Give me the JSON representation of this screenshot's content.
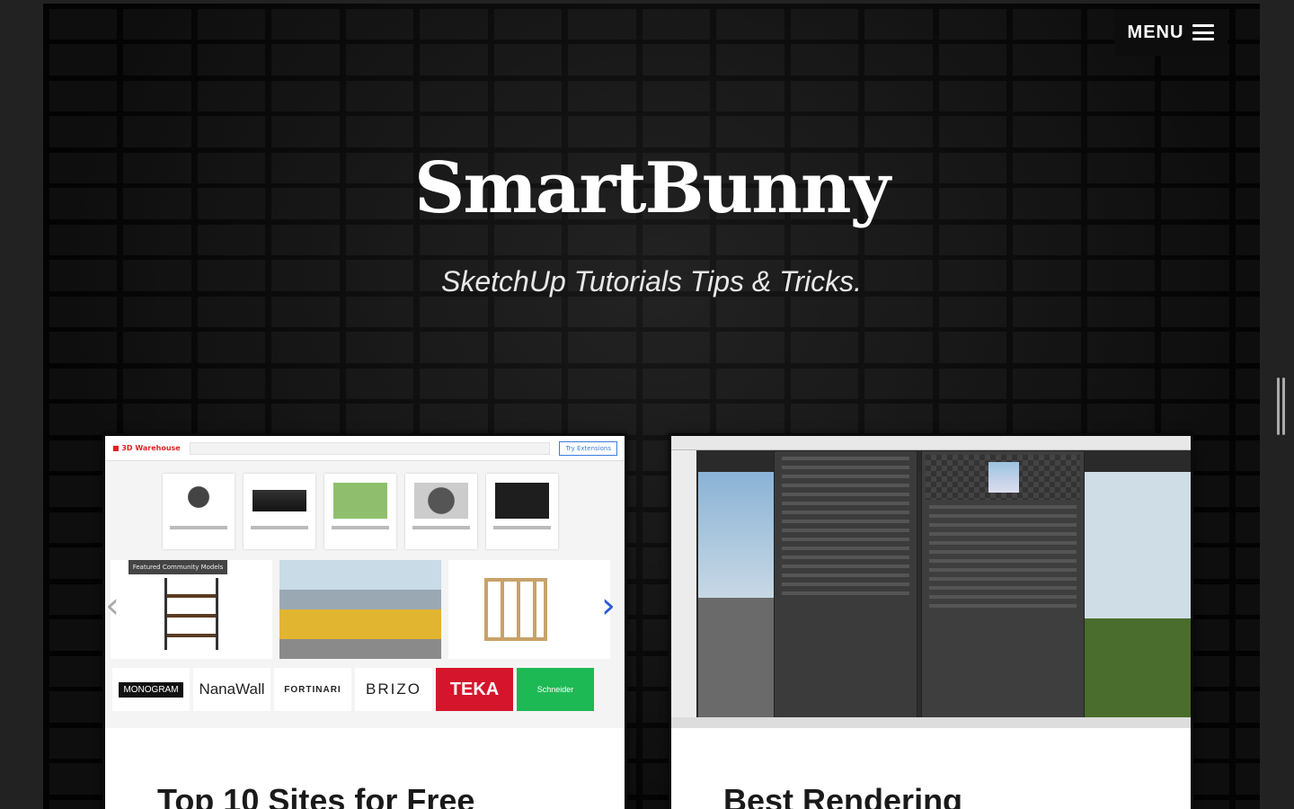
{
  "header": {
    "menu_label": "MENU"
  },
  "hero": {
    "title": "SmartBunny",
    "tagline": "SketchUp Tutorials Tips & Tricks."
  },
  "posts": [
    {
      "title": "Top 10 Sites for Free"
    },
    {
      "title": "Best Rendering"
    }
  ],
  "thumb1": {
    "brands": [
      "MONOGRAM",
      "NanaWall",
      "FORTINARI",
      "BRIZO",
      "TEKA",
      "Schneider"
    ],
    "try_label": "Try Extensions",
    "tooltip": "Featured Community Models"
  },
  "colors": {
    "background": "#151515",
    "card_bg": "#ffffff",
    "teka_red": "#d5152b",
    "schneider_green": "#1db954"
  }
}
